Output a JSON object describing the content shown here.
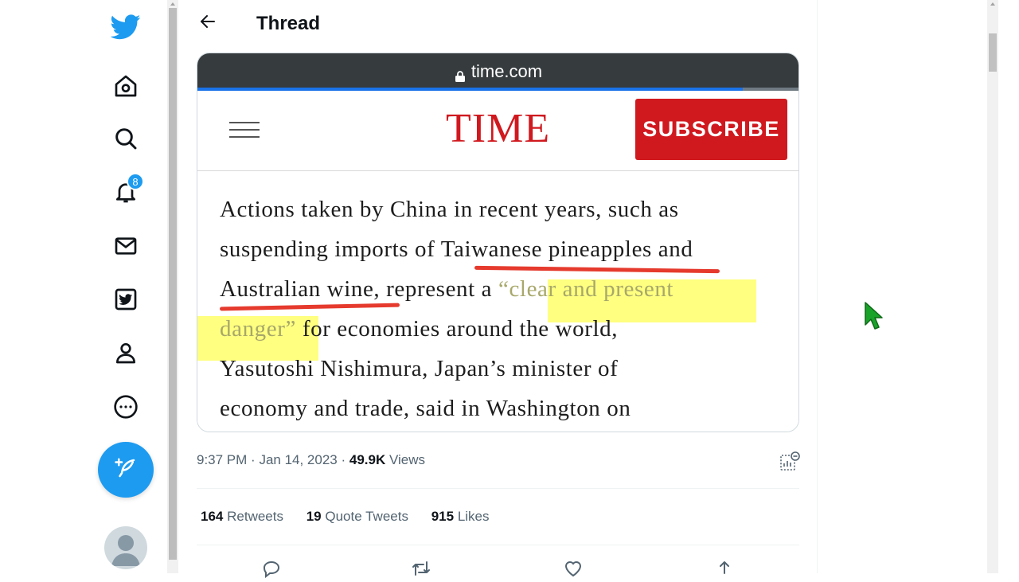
{
  "nav": {
    "notifications_count": "8"
  },
  "header": {
    "title": "Thread"
  },
  "embed": {
    "url": "time.com",
    "logo": "TIME",
    "subscribe_label": "SUBSCRIBE",
    "article_lines": [
      [
        "Actions taken by China in recent years, such as"
      ],
      [
        "suspending imports of Taiwanese pineapples and"
      ],
      [
        "Australian wine, represent a ",
        "“clear and present"
      ],
      [
        "danger”",
        " for economies around the world,"
      ],
      [
        "Yasutoshi Nishimura, Japan’s minister of"
      ],
      [
        "economy and trade, said in Washington on"
      ]
    ]
  },
  "tweet": {
    "time": "9:37 PM",
    "date": "Jan 14, 2023",
    "views_count": "49.9K",
    "views_label": "Views",
    "retweets_count": "164",
    "retweets_label": "Retweets",
    "quotes_count": "19",
    "quotes_label": "Quote Tweets",
    "likes_count": "915",
    "likes_label": "Likes"
  },
  "colors": {
    "accent": "#1d9bf0",
    "time_red": "#d0191f",
    "highlight": "#ffff80",
    "underline_red": "#e53a2d"
  },
  "icons": [
    "twitter-bird-icon",
    "home-icon",
    "search-icon",
    "bell-icon",
    "mail-icon",
    "twitter-blue-icon",
    "profile-icon",
    "more-icon",
    "compose-icon",
    "back-arrow-icon",
    "lock-icon",
    "analytics-icon",
    "reply-icon",
    "retweet-icon",
    "like-icon",
    "share-icon"
  ]
}
